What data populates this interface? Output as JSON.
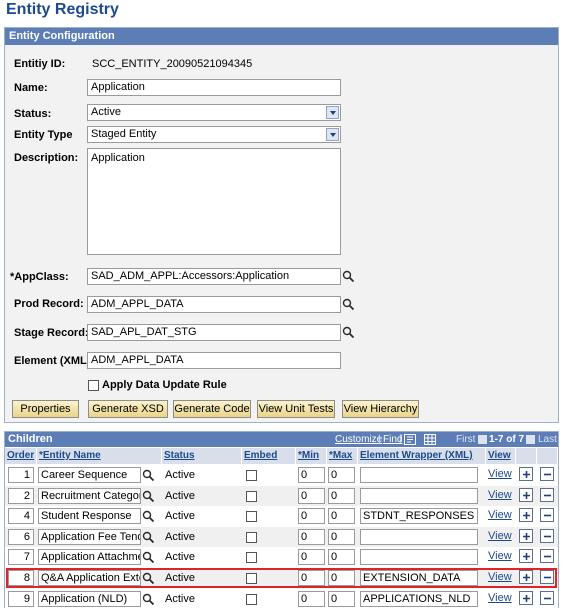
{
  "page_title": "Entity Registry",
  "config": {
    "header": "Entity Configuration",
    "entity_id_label": "Entitiy ID:",
    "entity_id_value": "SCC_ENTITY_20090521094345",
    "name_label": "Name:",
    "name_value": "Application",
    "status_label": "Status:",
    "status_value": "Active",
    "entity_type_label": "Entity Type",
    "entity_type_value": "Staged Entity",
    "description_label": "Description:",
    "description_value": "Application",
    "appclass_label": "*AppClass:",
    "appclass_value": "SAD_ADM_APPL:Accessors:Application",
    "prod_record_label": "Prod Record:",
    "prod_record_value": "ADM_APPL_DATA",
    "stage_record_label": "Stage Record:",
    "stage_record_value": "SAD_APL_DAT_STG",
    "element_label": "Element (XML):",
    "element_value": "ADM_APPL_DATA",
    "apply_rule_label": "Apply Data Update Rule",
    "buttons": {
      "properties": "Properties",
      "generate_xsd": "Generate XSD",
      "generate_code": "Generate Code",
      "view_unit_tests": "View Unit Tests",
      "view_hierarchy": "View Hierarchy"
    }
  },
  "children": {
    "header": "Children",
    "customize": "Customize",
    "find": "Find",
    "sep": "|",
    "first": "First",
    "range": "1-7 of 7",
    "last": "Last",
    "columns": {
      "order": "Order",
      "entity_name": "*Entity Name",
      "status": "Status",
      "embed": "Embed",
      "min": "*Min",
      "max": "*Max",
      "element_wrapper": "Element Wrapper (XML)",
      "view": "View"
    },
    "rows": [
      {
        "order": "1",
        "entity": "Career Sequence",
        "status": "Active",
        "min": "0",
        "max": "0",
        "wrapper": "",
        "view": "View"
      },
      {
        "order": "2",
        "entity": "Recruitment Category",
        "status": "Active",
        "min": "0",
        "max": "0",
        "wrapper": "",
        "view": "View"
      },
      {
        "order": "4",
        "entity": "Student Response",
        "status": "Active",
        "min": "0",
        "max": "0",
        "wrapper": "STDNT_RESPONSES",
        "view": "View"
      },
      {
        "order": "6",
        "entity": "Application Fee Tender",
        "status": "Active",
        "min": "0",
        "max": "0",
        "wrapper": "",
        "view": "View"
      },
      {
        "order": "7",
        "entity": "Application Attachment",
        "status": "Active",
        "min": "0",
        "max": "0",
        "wrapper": "",
        "view": "View"
      },
      {
        "order": "8",
        "entity": "Q&A Application Extension",
        "status": "Active",
        "min": "0",
        "max": "0",
        "wrapper": "EXTENSION_DATA",
        "view": "View"
      },
      {
        "order": "9",
        "entity": "Application (NLD)",
        "status": "Active",
        "min": "0",
        "max": "0",
        "wrapper": "APPLICATIONS_NLD",
        "view": "View"
      }
    ]
  },
  "colors": {
    "title": "#1c4a8c",
    "header_bg": "#5c7db6",
    "button_bg": "#f6e7a9",
    "highlight_border": "#e0232a"
  },
  "icons": [
    "lookup-icon",
    "dropdown-arrow-icon",
    "add-row-icon",
    "delete-row-icon",
    "download-icon",
    "grid-icon"
  ]
}
